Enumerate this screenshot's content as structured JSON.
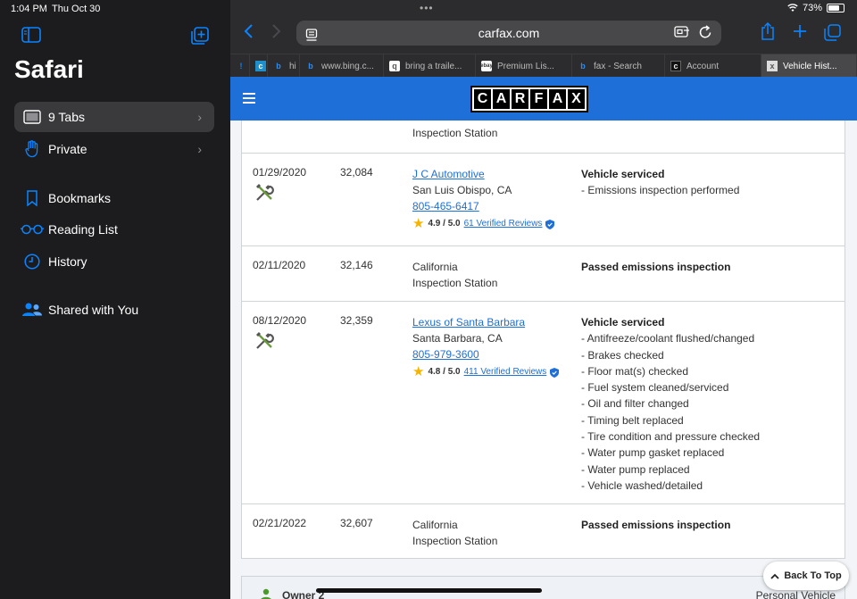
{
  "status": {
    "time": "1:04 PM",
    "date": "Thu Oct 30",
    "battery": "73%",
    "battery_level": 0.73
  },
  "sidebar": {
    "title": "Safari",
    "items": [
      {
        "label": "9 Tabs",
        "icon": "tabs-icon",
        "selected": true
      },
      {
        "label": "Private",
        "icon": "hand-icon"
      },
      {
        "label": "Bookmarks",
        "icon": "bookmark-icon"
      },
      {
        "label": "Reading List",
        "icon": "glasses-icon"
      },
      {
        "label": "History",
        "icon": "clock-icon"
      },
      {
        "label": "Shared with You",
        "icon": "people-icon"
      }
    ]
  },
  "browser": {
    "url": "carfax.com",
    "tabs": [
      {
        "label": "",
        "icon": "!"
      },
      {
        "label": "",
        "icon": "c"
      },
      {
        "label": "hi",
        "icon": "b"
      },
      {
        "label": "www.bing.c...",
        "icon": "b"
      },
      {
        "label": "bring a traile...",
        "icon": "q"
      },
      {
        "label": "Premium Lis...",
        "icon": "ebay"
      },
      {
        "label": "fax - Search",
        "icon": "b"
      },
      {
        "label": "Account",
        "icon": "c"
      },
      {
        "label": "Vehicle Hist...",
        "icon": "x",
        "active": true
      }
    ]
  },
  "carfax": {
    "logo_letters": [
      "C",
      "A",
      "R",
      "F",
      "A",
      "X"
    ],
    "partial_row": {
      "source": "Inspection Station"
    },
    "records": [
      {
        "date": "01/29/2020",
        "mileage": "32,084",
        "source_name": "J C Automotive",
        "source_location": "San Luis Obispo, CA",
        "source_phone": "805-465-6417",
        "rating": "4.9 / 5.0",
        "reviews": "61 Verified Reviews",
        "detail_title": "Vehicle serviced",
        "details": [
          "- Emissions inspection performed"
        ]
      },
      {
        "date": "02/11/2020",
        "mileage": "32,146",
        "source_line1": "California",
        "source_line2": "Inspection Station",
        "detail_title": "Passed emissions inspection"
      },
      {
        "date": "08/12/2020",
        "mileage": "32,359",
        "source_name": "Lexus of Santa Barbara",
        "source_location": "Santa Barbara, CA",
        "source_phone": "805-979-3600",
        "rating": "4.8 / 5.0",
        "reviews": "411 Verified Reviews",
        "detail_title": "Vehicle serviced",
        "details": [
          "- Antifreeze/coolant flushed/changed",
          "- Brakes checked",
          "- Floor mat(s) checked",
          "- Fuel system cleaned/serviced",
          "- Oil and filter changed",
          "- Timing belt replaced",
          "- Tire condition and pressure checked",
          "- Water pump gasket replaced",
          "- Water pump replaced",
          "- Vehicle washed/detailed"
        ]
      },
      {
        "date": "02/21/2022",
        "mileage": "32,607",
        "source_line1": "California",
        "source_line2": "Inspection Station",
        "detail_title": "Passed emissions inspection"
      }
    ],
    "owner": {
      "label": "Owner 2",
      "type": "Personal Vehicle"
    },
    "back_to_top": "Back To Top"
  },
  "colors": {
    "carfax_blue": "#1e6fd8",
    "safari_blue": "#0a84ff"
  }
}
